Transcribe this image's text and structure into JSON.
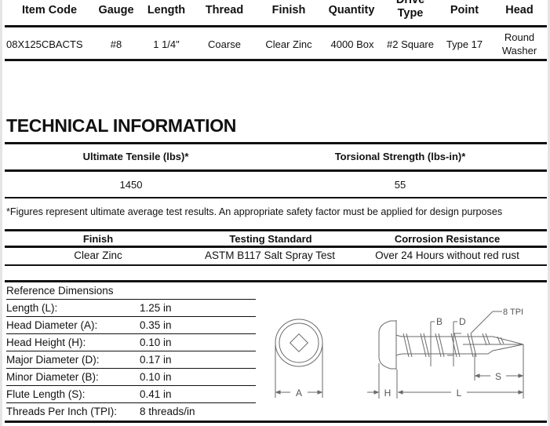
{
  "product_table": {
    "headers": [
      "Item Code",
      "Gauge",
      "Length",
      "Thread",
      "Finish",
      "Quantity",
      "Drive Type",
      "Point",
      "Head"
    ],
    "header_lines": {
      "drive_type": [
        "Drive",
        "Type"
      ]
    },
    "row": {
      "item_code": "08X125CBACTS",
      "gauge": "#8",
      "length": "1 1/4\"",
      "thread": "Coarse",
      "finish": "Clear Zinc",
      "quantity": "4000 Box",
      "drive_type": "#2 Square",
      "point": "Type 17",
      "head_line1": "Round",
      "head_line2": "Washer"
    }
  },
  "technical": {
    "title": "TECHNICAL INFORMATION",
    "strength": {
      "headers": [
        "Ultimate Tensile (lbs)*",
        "Torsional Strength (lbs-in)*"
      ],
      "values": [
        "1450",
        "55"
      ]
    },
    "note": "*Figures represent ultimate average test results. An appropriate safety factor must be applied for design purposes",
    "finish_table": {
      "headers": [
        "Finish",
        "Testing Standard",
        "Corrosion Resistance"
      ],
      "values": [
        "Clear Zinc",
        "ASTM B117 Salt Spray Test",
        "Over 24 Hours without red rust"
      ]
    }
  },
  "reference_dimensions": {
    "title": "Reference Dimensions",
    "rows": [
      {
        "label": "Length (L):",
        "value": "1.25 in"
      },
      {
        "label": "Head Diameter (A):",
        "value": "0.35 in"
      },
      {
        "label": "Head Height (H):",
        "value": "0.10 in"
      },
      {
        "label": "Major Diameter (D):",
        "value": "0.17 in"
      },
      {
        "label": "Minor Diameter (B):",
        "value": "0.10 in"
      },
      {
        "label": "Flute Length (S):",
        "value": "0.41 in"
      },
      {
        "label": "Threads Per Inch (TPI):",
        "value": "8 threads/in"
      }
    ]
  },
  "diagram": {
    "labels": {
      "a": "A",
      "h": "H",
      "l": "L",
      "s": "S",
      "b": "B",
      "d": "D",
      "tpi": "8 TPI"
    },
    "line_color": "#6a6a6a"
  }
}
